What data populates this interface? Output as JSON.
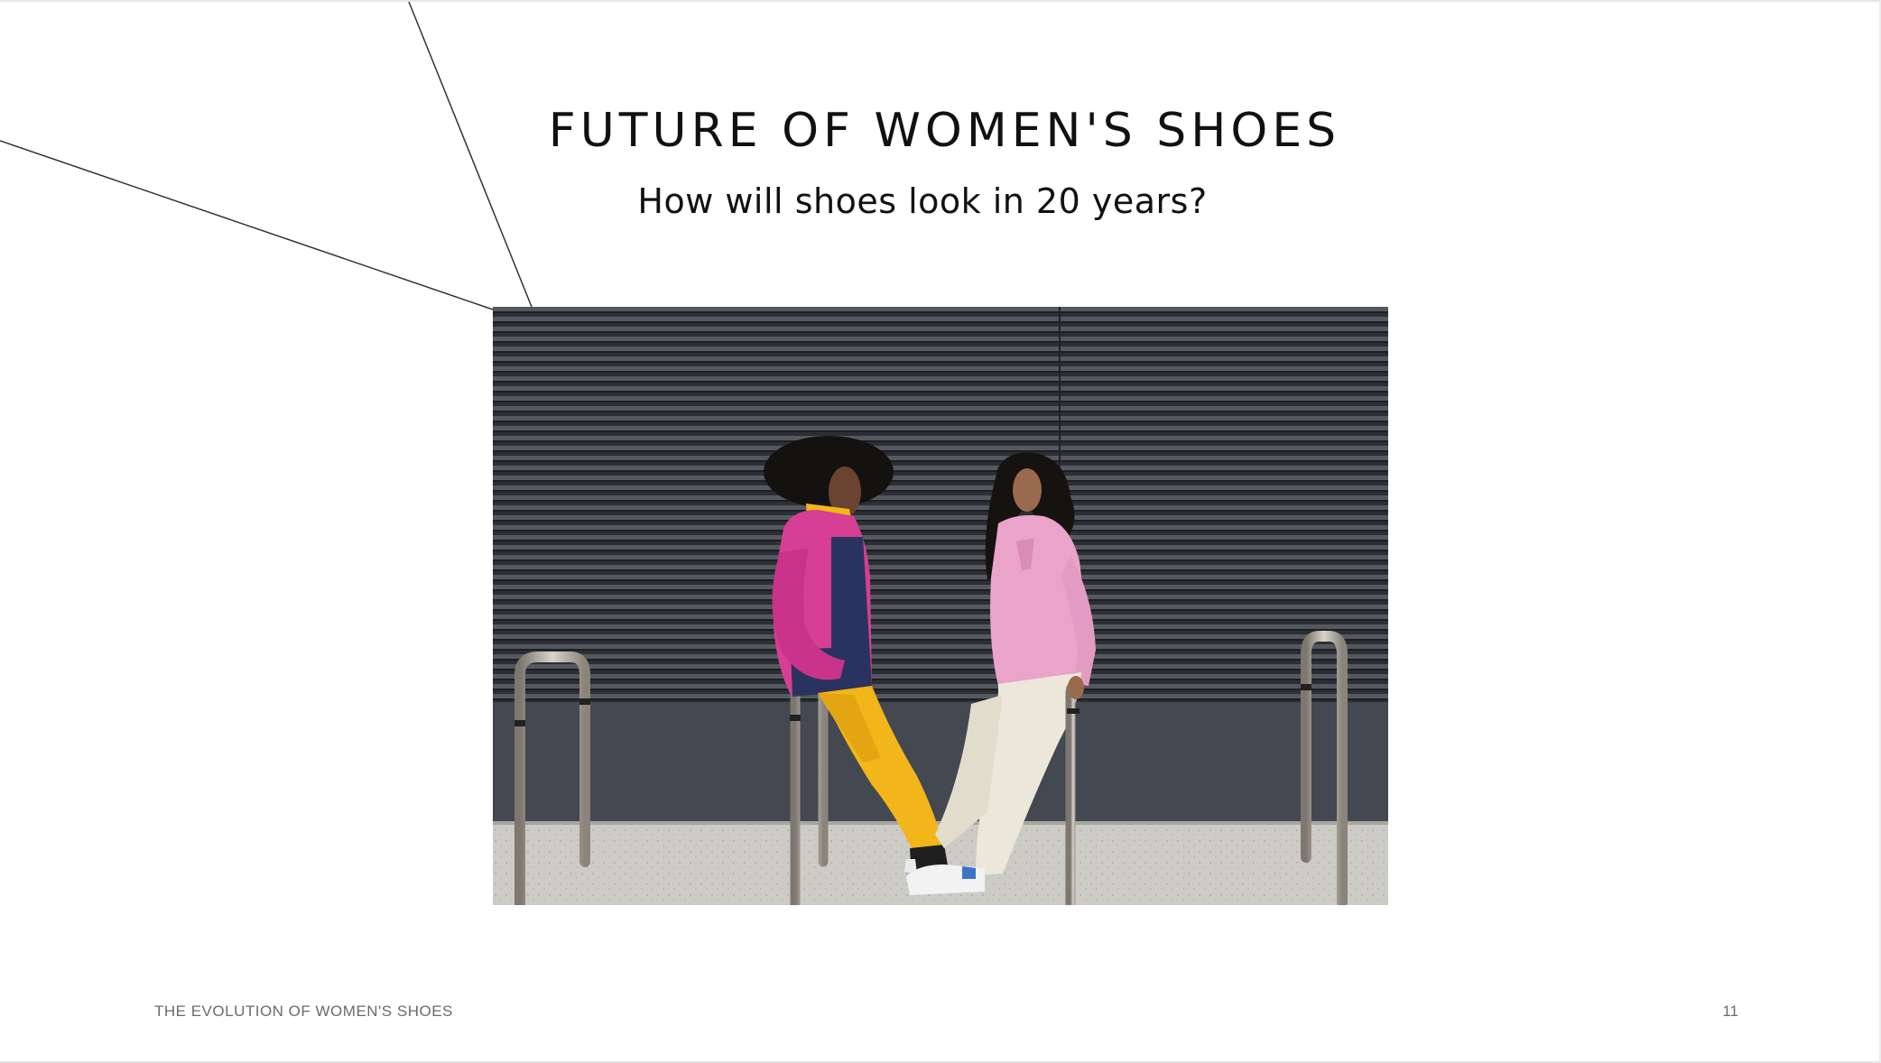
{
  "slide": {
    "title": "FUTURE OF WOMEN'S SHOES",
    "subtitle": "How will shoes look in 20 years?",
    "footer_label": "THE EVOLUTION OF WOMEN'S SHOES",
    "page_number": "11"
  },
  "photo": {
    "subject": "two people leaning on metal bike rails in front of a dark ribbed wall",
    "colors": {
      "wall": "#3a3d43",
      "pavement": "#c9c7c3",
      "jacket_pink": "#d63f93",
      "jacket_navy": "#2a3360",
      "trousers_yellow": "#f2b51a",
      "hoodie_pink": "#eaa3c9",
      "trousers_cream": "#ece7da"
    }
  },
  "colors": {
    "background": "#ffffff",
    "text": "#111111",
    "footer_text": "#6b6b6b",
    "deco_line": "#333333"
  }
}
